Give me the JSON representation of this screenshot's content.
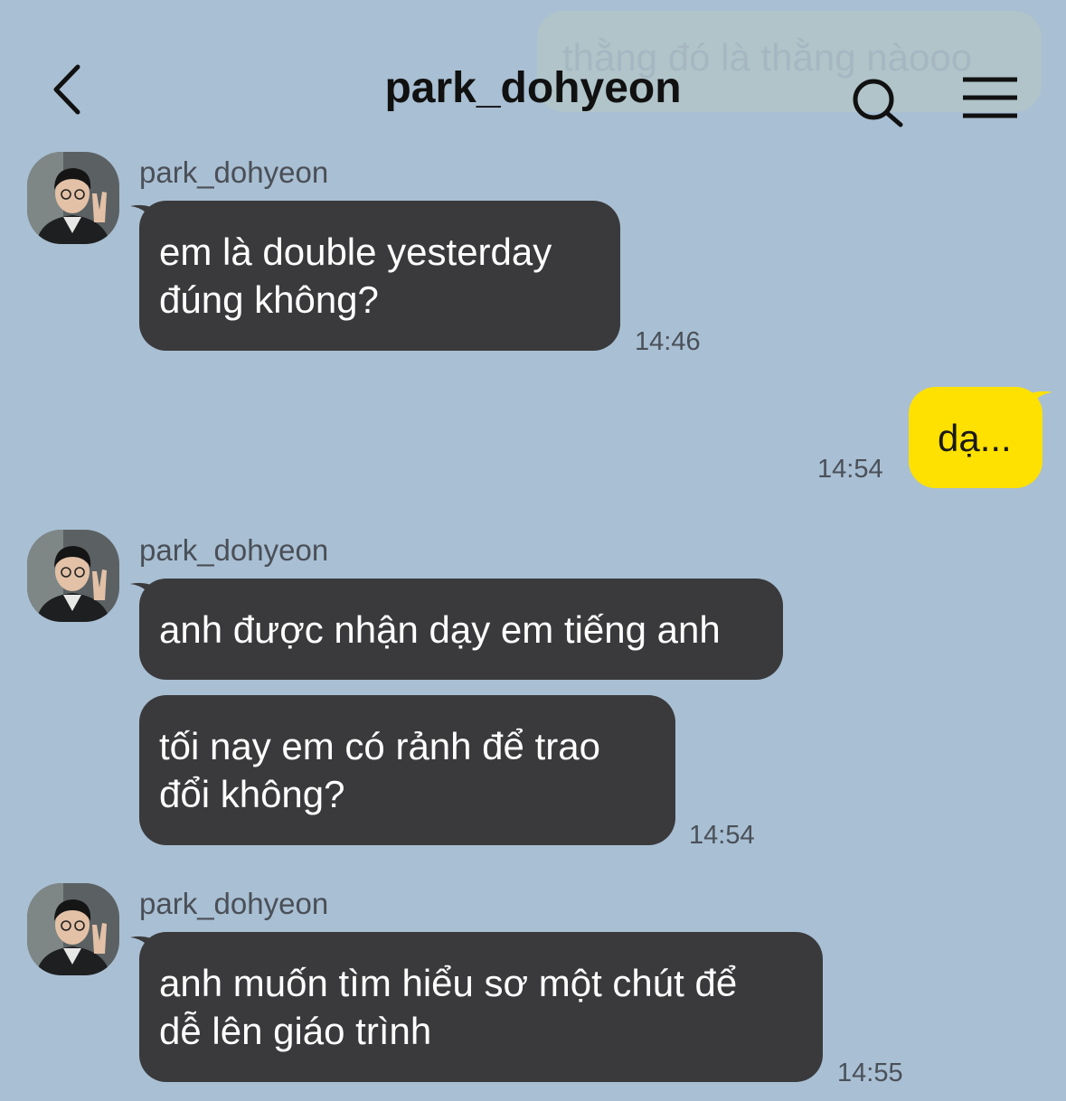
{
  "header": {
    "title": "park_dohyeon",
    "back_icon": "chevron-left-icon",
    "search_icon": "search-icon",
    "menu_icon": "menu-icon"
  },
  "background_overlay": {
    "text": "thằng đó là thằng nàooo"
  },
  "colors": {
    "background": "#A9BFD3",
    "incoming_bubble": "#3A3A3C",
    "outgoing_bubble": "#FFE100"
  },
  "messages": [
    {
      "sender": "park_dohyeon",
      "bubbles": [
        "em là double yesterday\nđúng không?"
      ],
      "time": "14:46"
    },
    {
      "sender": "me",
      "bubbles": [
        "dạ..."
      ],
      "time": "14:54"
    },
    {
      "sender": "park_dohyeon",
      "bubbles": [
        "anh được nhận dạy em tiếng anh",
        "tối nay em có rảnh để trao\nđổi không?"
      ],
      "time": "14:54"
    },
    {
      "sender": "park_dohyeon",
      "bubbles": [
        "anh muốn tìm hiểu sơ một chút để\ndễ lên giáo trình"
      ],
      "time": "14:55"
    }
  ]
}
